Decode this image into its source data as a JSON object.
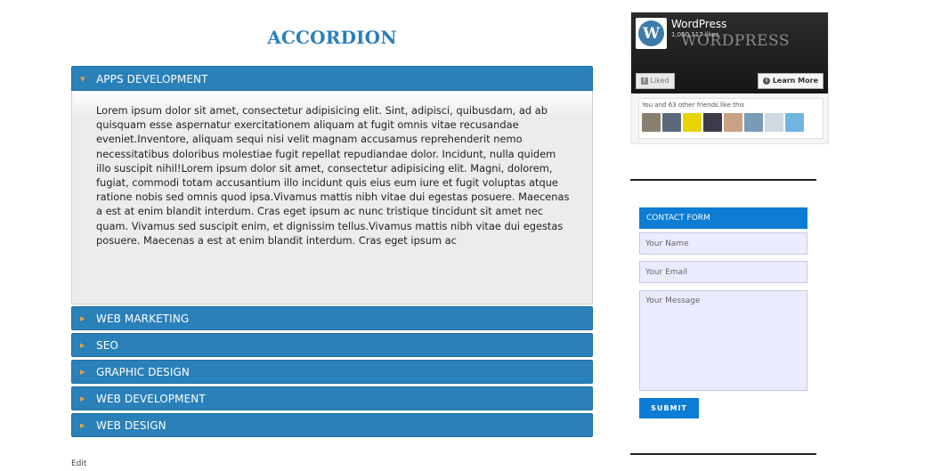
{
  "page": {
    "title": "ACCORDION",
    "edit_link": "Edit"
  },
  "accordion": {
    "items": [
      {
        "label": "APPS DEVELOPMENT",
        "expanded": true,
        "content": "Lorem ipsum dolor sit amet, consectetur adipisicing elit. Sint, adipisci, quibusdam, ad ab quisquam esse aspernatur exercitationem aliquam at fugit omnis vitae recusandae eveniet.Inventore, aliquam sequi nisi velit magnam accusamus reprehenderit nemo necessitatibus doloribus molestiae fugit repellat repudiandae dolor. Incidunt, nulla quidem illo suscipit nihil!Lorem ipsum dolor sit amet, consectetur adipisicing elit. Magni, dolorem, fugiat, commodi totam accusantium illo incidunt quis eius eum iure et fugit voluptas atque ratione nobis sed omnis quod ipsa.Vivamus mattis nibh vitae dui egestas posuere. Maecenas a est at enim blandit interdum. Cras eget ipsum ac nunc tristique tincidunt sit amet nec quam. Vivamus sed suscipit enim, et dignissim tellus.Vivamus mattis nibh vitae dui egestas posuere. Maecenas a est at enim blandit interdum. Cras eget ipsum ac"
      },
      {
        "label": "WEB MARKETING",
        "expanded": false
      },
      {
        "label": "SEO",
        "expanded": false
      },
      {
        "label": "GRAPHIC DESIGN",
        "expanded": false
      },
      {
        "label": "WEB DEVELOPMENT",
        "expanded": false
      },
      {
        "label": "WEB DESIGN",
        "expanded": false
      }
    ],
    "arrow_expanded": "▼",
    "arrow_collapsed": "▶"
  },
  "facebook_widget": {
    "page_name": "WordPress",
    "likes": "1,050,117 likes",
    "cover_wordmark": "WORDPRESS",
    "logo_letter": "W",
    "liked_label": "Liked",
    "learn_more_label": "Learn More",
    "friends_text": "You and 63 other friends like this",
    "avatar_colors": [
      "#8a7f70",
      "#5a6a7a",
      "#e8d400",
      "#3b3b4a",
      "#c9a184",
      "#7a9ab8",
      "#d0d8e0",
      "#6fb5e0"
    ]
  },
  "contact_form": {
    "title": "CONTACT FORM",
    "name_placeholder": "Your Name",
    "email_placeholder": "Your Email",
    "message_placeholder": "Your Message",
    "submit_label": "SUBMIT"
  },
  "colors": {
    "accent": "#2a80b9",
    "form_accent": "#0c7cd5",
    "arrow": "#e8a33a",
    "input_bg": "#ebebff"
  }
}
